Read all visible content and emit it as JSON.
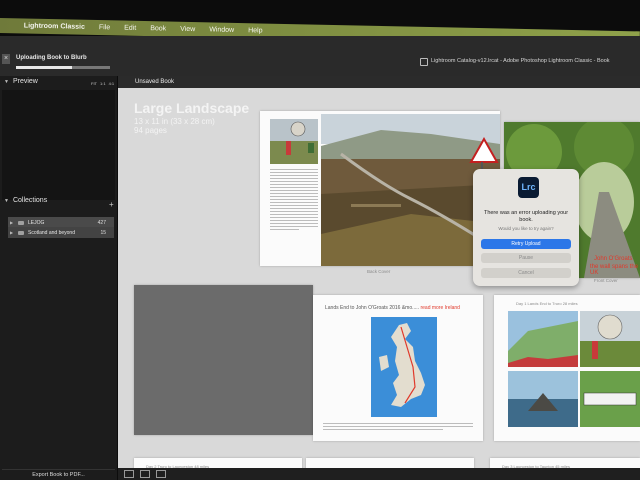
{
  "menubar": {
    "app_name": "Lightroom Classic",
    "items": [
      "File",
      "Edit",
      "Book",
      "View",
      "Window",
      "Help"
    ]
  },
  "activity": {
    "title": "Uploading Book to Blurb",
    "progress": 0.6
  },
  "window": {
    "title": "Lightroom Catalog-v12.lrcat - Adobe Photoshop Lightroom Classic - Book"
  },
  "left_panel": {
    "preview_header": "Preview",
    "zoom_options": [
      "FIT",
      "1:1",
      "4:1"
    ],
    "collections_header": "Collections",
    "add_label": "+",
    "collections": [
      {
        "name": "LEJOG",
        "count": "427"
      },
      {
        "name": "Scotland and beyond",
        "count": "15"
      }
    ],
    "export_button": "Export Book to PDF..."
  },
  "main": {
    "tab_label": "Unsaved Book",
    "book_title": "Large Landscape",
    "book_size": "13 x 11 in (33 x 28 cm)",
    "book_pages": "94 pages",
    "back_cover_label": "Back Cover",
    "front_cover_label": "Front Cover",
    "cover_text_line1": "John O'Groats",
    "cover_text_line2": "the wall spans the UK",
    "page_heading": "Lands End to John O'Groats 2016 &mo.....",
    "page_heading_note": "read more Ireland",
    "right_page_heading": "Day 1 Lands End to Truro 28 miles",
    "bottom_left_heading": "Day 2 Truro to Launceston 48 miles",
    "bottom_right_heading": "Day 3 Launceston to Taunton 45 miles"
  },
  "dialog": {
    "app_badge": "Lrc",
    "message": "There was an error uploading your book.",
    "sub_message": "Would you like to try again?",
    "primary_button": "Retry Upload",
    "pause_button": "Pause",
    "cancel_button": "Cancel"
  },
  "colors": {
    "menubar": "#7d8c40",
    "panel": "#1c1c1c",
    "canvas": "#d9d9d9",
    "accent": "#2c77e8"
  }
}
